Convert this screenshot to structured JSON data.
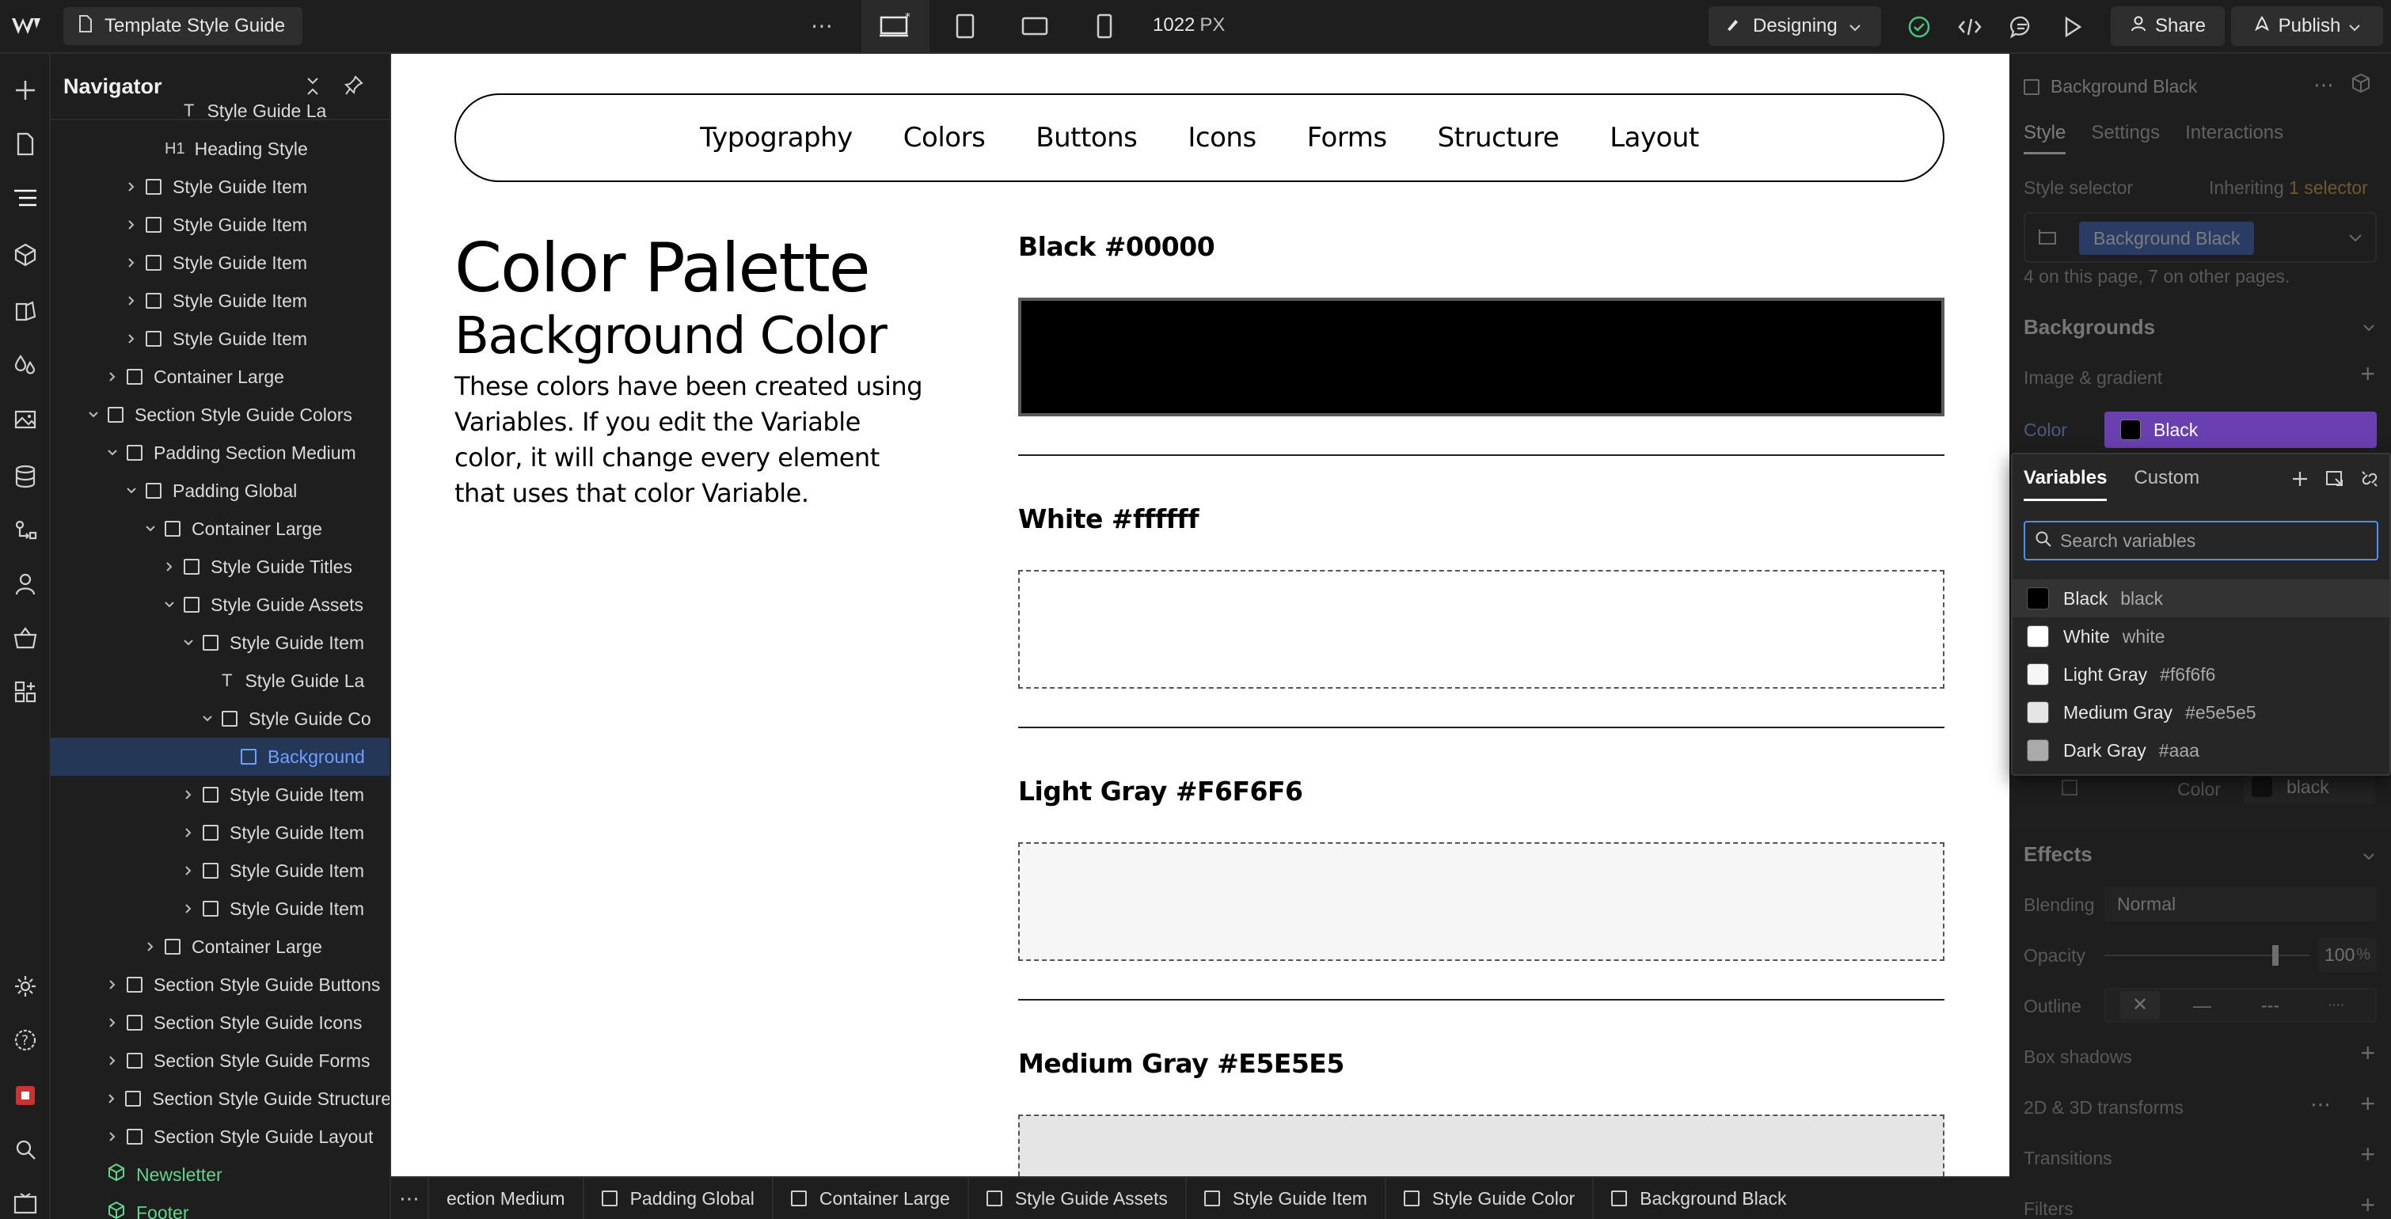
{
  "topbar": {
    "page_name": "Template Style Guide",
    "more": "⋯",
    "width_value": "1022",
    "width_unit": "PX",
    "mode": "Designing",
    "share": "Share",
    "publish": "Publish"
  },
  "navigator": {
    "title": "Navigator",
    "items": [
      {
        "label": "Style Guide La",
        "type": "text"
      },
      {
        "label": "Heading Style",
        "type": "h1"
      },
      {
        "label": "Style Guide Item",
        "type": "box"
      },
      {
        "label": "Style Guide Item",
        "type": "box"
      },
      {
        "label": "Style Guide Item",
        "type": "box"
      },
      {
        "label": "Style Guide Item",
        "type": "box"
      },
      {
        "label": "Style Guide Item",
        "type": "box"
      },
      {
        "label": "Container Large",
        "type": "box"
      },
      {
        "label": "Section Style Guide Colors",
        "type": "box"
      },
      {
        "label": "Padding Section Medium",
        "type": "box"
      },
      {
        "label": "Padding Global",
        "type": "box"
      },
      {
        "label": "Container Large",
        "type": "box"
      },
      {
        "label": "Style Guide Titles",
        "type": "box"
      },
      {
        "label": "Style Guide Assets",
        "type": "box"
      },
      {
        "label": "Style Guide Item",
        "type": "box"
      },
      {
        "label": "Style Guide La",
        "type": "text"
      },
      {
        "label": "Style Guide Co",
        "type": "box"
      },
      {
        "label": "Background",
        "type": "box"
      },
      {
        "label": "Style Guide Item",
        "type": "box"
      },
      {
        "label": "Style Guide Item",
        "type": "box"
      },
      {
        "label": "Style Guide Item",
        "type": "box"
      },
      {
        "label": "Style Guide Item",
        "type": "box"
      },
      {
        "label": "Container Large",
        "type": "box"
      },
      {
        "label": "Section Style Guide Buttons",
        "type": "box"
      },
      {
        "label": "Section Style Guide Icons",
        "type": "box"
      },
      {
        "label": "Section Style Guide Forms",
        "type": "box"
      },
      {
        "label": "Section Style Guide Structure",
        "type": "box"
      },
      {
        "label": "Section Style Guide Layout",
        "type": "box"
      },
      {
        "label": "Newsletter",
        "type": "component"
      },
      {
        "label": "Footer",
        "type": "component"
      }
    ]
  },
  "canvas": {
    "nav_links": [
      "Typography",
      "Colors",
      "Buttons",
      "Icons",
      "Forms",
      "Structure",
      "Layout"
    ],
    "title": "Color Palette",
    "subtitle": "Background Color",
    "description": "These colors have been created using Variables. If you edit the Variable color, it will change every element that uses that color Variable.",
    "swatches": [
      {
        "label": "Black #00000",
        "color": "#000000"
      },
      {
        "label": "White #ffffff",
        "color": "#ffffff"
      },
      {
        "label": "Light Gray #F6F6F6",
        "color": "#f6f6f6"
      },
      {
        "label": "Medium Gray  #E5E5E5",
        "color": "#e5e5e5"
      }
    ]
  },
  "breadcrumb": {
    "more": "⋯",
    "items": [
      "ection Medium",
      "Padding Global",
      "Container Large",
      "Style Guide Assets",
      "Style Guide Item",
      "Style Guide Color",
      "Background Black"
    ]
  },
  "rightpanel": {
    "element_name": "Background Black",
    "tabs": [
      "Style",
      "Settings",
      "Interactions"
    ],
    "selector_label": "Style selector",
    "inheriting_prefix": "Inheriting",
    "inheriting_link": "1 selector",
    "selector_chip": "Background Black",
    "usage": "4 on this page, 7 on other pages.",
    "backgrounds_title": "Backgrounds",
    "image_gradient": "Image & gradient",
    "color_label": "Color",
    "color_value": "Black",
    "border_color_label": "Color",
    "border_color_value": "black",
    "effects_title": "Effects",
    "blending_label": "Blending",
    "blending_value": "Normal",
    "opacity_label": "Opacity",
    "opacity_value": "100",
    "opacity_unit": "%",
    "outline_label": "Outline",
    "box_shadows": "Box shadows",
    "transforms": "2D & 3D transforms",
    "transitions": "Transitions",
    "filters": "Filters"
  },
  "variables_popup": {
    "tabs": [
      "Variables",
      "Custom"
    ],
    "search_placeholder": "Search variables",
    "items": [
      {
        "name": "Black",
        "value": "black",
        "color": "#000000"
      },
      {
        "name": "White",
        "value": "white",
        "color": "#ffffff"
      },
      {
        "name": "Light Gray",
        "value": "#f6f6f6",
        "color": "#f6f6f6"
      },
      {
        "name": "Medium Gray",
        "value": "#e5e5e5",
        "color": "#e5e5e5"
      },
      {
        "name": "Dark Gray",
        "value": "#aaa",
        "color": "#aaaaaa"
      }
    ]
  },
  "colors": {
    "selection_bg": "#243757",
    "selection_text": "#6ea0ff",
    "accent_blue": "#4e8cff",
    "color_field": "#6a3fb0",
    "component_green": "#64d38c"
  }
}
